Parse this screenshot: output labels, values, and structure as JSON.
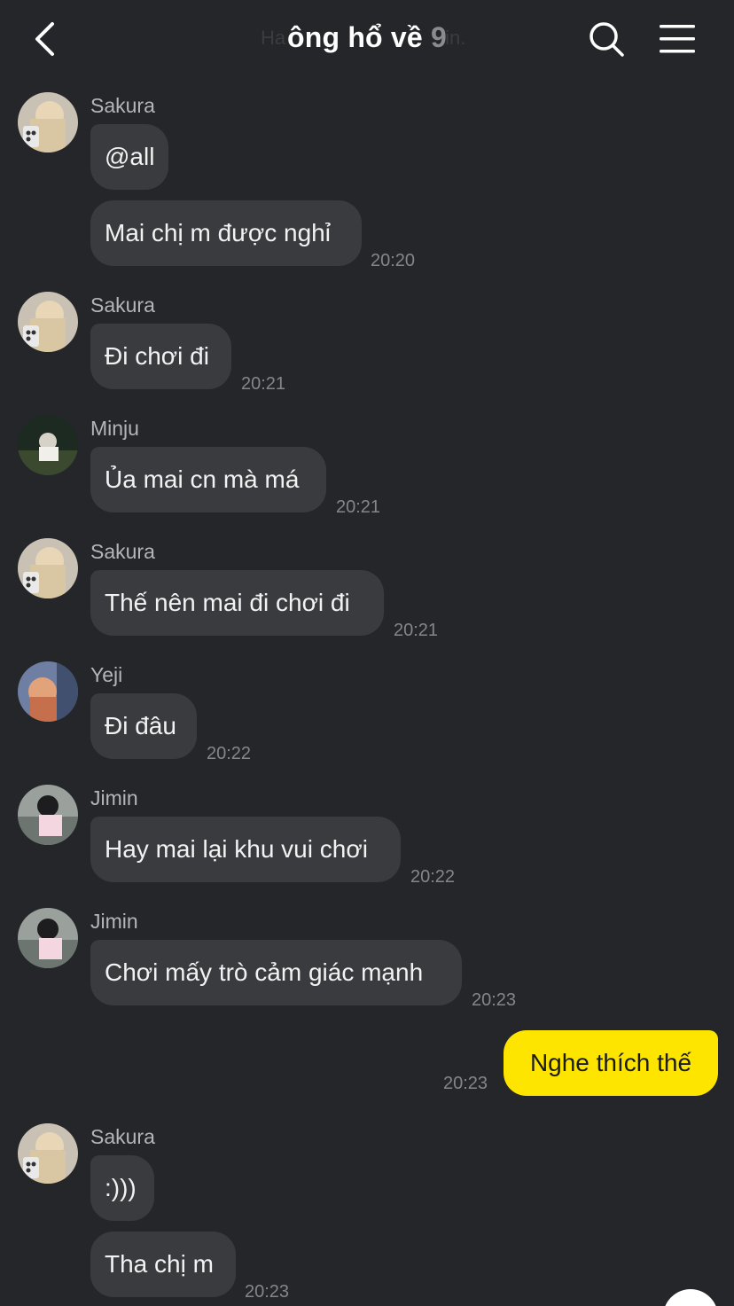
{
  "header": {
    "title_name": "ông hổ về",
    "member_count": "9",
    "ghost_left": "Ha",
    "ghost_right": "in."
  },
  "messages": [
    {
      "sender": "Sakura",
      "bubbles": [
        "@all",
        "Mai chị m được nghỉ"
      ],
      "time": "20:20"
    },
    {
      "sender": "Sakura",
      "bubbles": [
        "Đi chơi đi"
      ],
      "time": "20:21"
    },
    {
      "sender": "Minju",
      "bubbles": [
        "Ủa mai cn mà má"
      ],
      "time": "20:21"
    },
    {
      "sender": "Sakura",
      "bubbles": [
        "Thế nên mai đi chơi đi"
      ],
      "time": "20:21"
    },
    {
      "sender": "Yeji",
      "bubbles": [
        "Đi đâu"
      ],
      "time": "20:22"
    },
    {
      "sender": "Jimin",
      "bubbles": [
        "Hay mai lại khu vui chơi"
      ],
      "time": "20:22"
    },
    {
      "sender": "Jimin",
      "bubbles": [
        "Chơi mấy trò cảm giác mạnh"
      ],
      "time": "20:23"
    },
    {
      "sender": "me",
      "bubbles": [
        "Nghe thích thế"
      ],
      "time": "20:23"
    },
    {
      "sender": "Sakura",
      "bubbles": [
        ":)))",
        "Tha chị m"
      ],
      "time": "20:23"
    }
  ],
  "icons": {
    "back": "chevron-left-icon",
    "search": "search-icon",
    "menu": "hamburger-menu-icon"
  },
  "colors": {
    "background": "#252629",
    "bubble_other": "#3a3b3f",
    "bubble_mine": "#fee500"
  }
}
